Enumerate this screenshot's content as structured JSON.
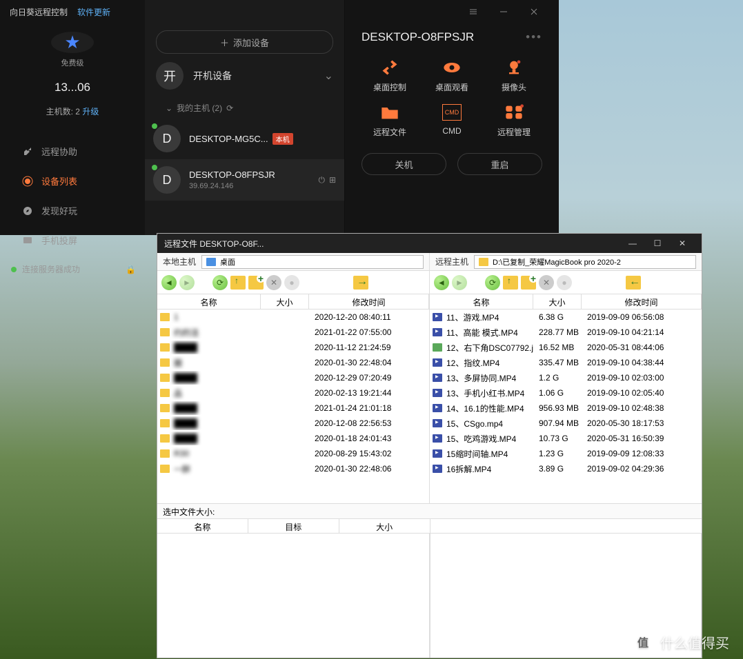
{
  "app": {
    "title": "向日葵远程控制",
    "update": "软件更新"
  },
  "sidebar": {
    "tier": "免费级",
    "id_masked": "13...06",
    "host_count_label": "主机数: 2 ",
    "upgrade": "升级",
    "nav": {
      "assist": "远程协助",
      "devices": "设备列表",
      "discover": "发现好玩",
      "phone": "手机投屏"
    },
    "conn_status": "连接服务器成功"
  },
  "mid": {
    "add": "添加设备",
    "startup": "开机设备",
    "startup_circ": "开",
    "section_label": "我的主机 (2)",
    "devices": [
      {
        "letter": "D",
        "name": "DESKTOP-MG5C...",
        "self_tag": "本机",
        "ip": ""
      },
      {
        "letter": "D",
        "name": "DESKTOP-O8FPSJR",
        "self_tag": "",
        "ip": "39.69.24.146"
      }
    ]
  },
  "right": {
    "title": "DESKTOP-O8FPSJR",
    "cells": {
      "desktop_ctrl": "桌面控制",
      "desktop_view": "桌面观看",
      "camera": "摄像头",
      "files": "远程文件",
      "cmd": "CMD",
      "manage": "远程管理"
    },
    "cmd_icon_text": "CMD",
    "shutdown": "关机",
    "restart": "重启"
  },
  "fwin": {
    "title": "远程文件 DESKTOP-O8F...",
    "local_label": "本地主机",
    "remote_label": "远程主机",
    "local_path": "桌面",
    "remote_path": "D:\\已复制_荣耀MagicBook pro 2020-2",
    "col_name": "名称",
    "col_size": "大小",
    "col_mtime": "修改时间",
    "status": "选中文件大小:",
    "q_name": "名称",
    "q_target": "目标",
    "q_size": "大小",
    "local_rows": [
      {
        "name": "1",
        "size": "",
        "mtime": "2020-12-20 08:40:11",
        "blur": true
      },
      {
        "name": "约的活",
        "size": "",
        "mtime": "2021-01-22 07:55:00",
        "blur": true
      },
      {
        "name": "",
        "size": "",
        "mtime": "2020-11-12 21:24:59",
        "blur": true
      },
      {
        "name": "圈",
        "size": "",
        "mtime": "2020-01-30 22:48:04",
        "blur": true
      },
      {
        "name": "",
        "size": "",
        "mtime": "2020-12-29 07:20:49",
        "blur": true
      },
      {
        "name": "品",
        "size": "",
        "mtime": "2020-02-13 19:21:44",
        "blur": true
      },
      {
        "name": "",
        "size": "",
        "mtime": "2021-01-24 21:01:18",
        "blur": true
      },
      {
        "name": "",
        "size": "",
        "mtime": "2020-12-08 22:56:53",
        "blur": true
      },
      {
        "name": "",
        "size": "",
        "mtime": "2020-01-18 24:01:43",
        "blur": true
      },
      {
        "name": "R30",
        "size": "",
        "mtime": "2020-08-29 15:43:02",
        "blur": true
      },
      {
        "name": "一醉",
        "size": "",
        "mtime": "2020-01-30 22:48:06",
        "blur": true
      }
    ],
    "remote_rows": [
      {
        "ic": "m",
        "name": "11、游戏.MP4",
        "size": "6.38 G",
        "mtime": "2019-09-09 06:56:08"
      },
      {
        "ic": "m",
        "name": "11、高能 模式.MP4",
        "size": "228.77 MB",
        "mtime": "2019-09-10 04:21:14"
      },
      {
        "ic": "j",
        "name": "12、右下角DSC07792.j",
        "size": "16.52 MB",
        "mtime": "2020-05-31 08:44:06"
      },
      {
        "ic": "m",
        "name": "12、指纹.MP4",
        "size": "335.47 MB",
        "mtime": "2019-09-10 04:38:44"
      },
      {
        "ic": "m",
        "name": "13、多屏协同.MP4",
        "size": "1.2 G",
        "mtime": "2019-09-10 02:03:00"
      },
      {
        "ic": "m",
        "name": "13、手机小红书.MP4",
        "size": "1.06 G",
        "mtime": "2019-09-10 02:05:40"
      },
      {
        "ic": "m",
        "name": "14、16.1的性能.MP4",
        "size": "956.93 MB",
        "mtime": "2019-09-10 02:48:38"
      },
      {
        "ic": "m",
        "name": "15、CSgo.mp4",
        "size": "907.94 MB",
        "mtime": "2020-05-30 18:17:53"
      },
      {
        "ic": "m",
        "name": "15、吃鸡游戏.MP4",
        "size": "10.73 G",
        "mtime": "2020-05-31 16:50:39"
      },
      {
        "ic": "m",
        "name": "15缩时间轴.MP4",
        "size": "1.23 G",
        "mtime": "2019-09-09 12:08:33"
      },
      {
        "ic": "m",
        "name": "16拆解.MP4",
        "size": "3.89 G",
        "mtime": "2019-09-02 04:29:36"
      }
    ]
  },
  "wm": {
    "badge": "值",
    "text": "什么值得买"
  }
}
